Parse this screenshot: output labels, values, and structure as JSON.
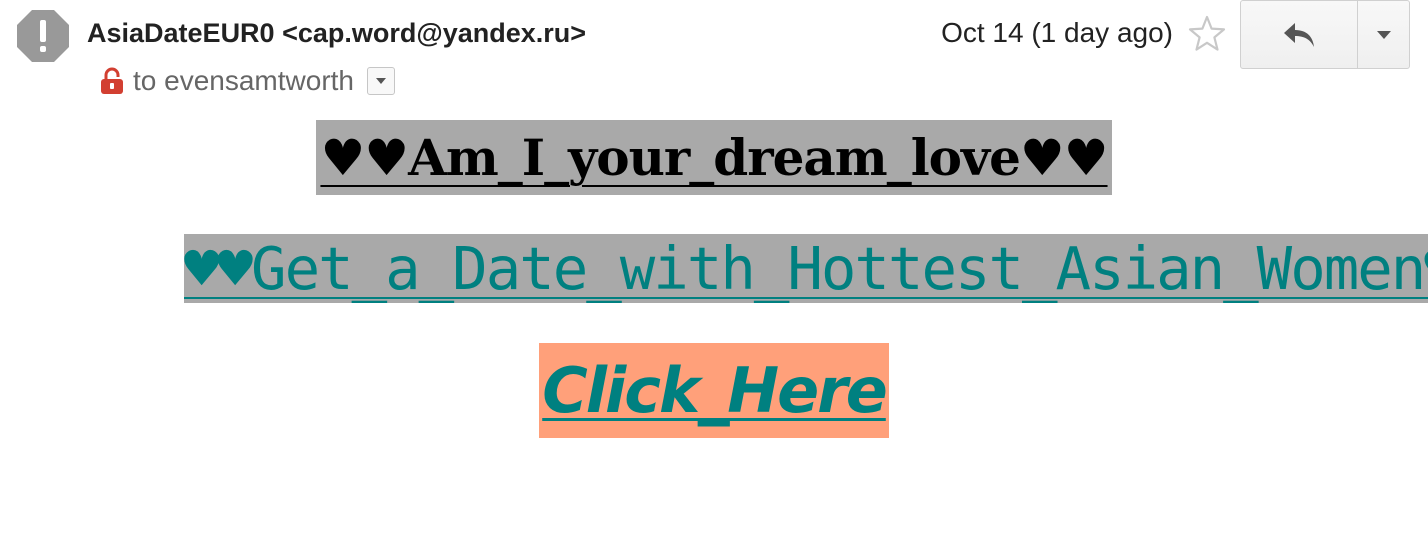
{
  "header": {
    "sender": "AsiaDateEUR0 <cap.word@yandex.ru>",
    "recipient": "to evensamtworth",
    "date": "Oct 14 (1 day ago)",
    "avatar_icon": "warning-octagon-icon",
    "lock_icon": "lock-open-icon",
    "star_icon": "star-outline-icon",
    "reply_icon": "reply-arrow-icon",
    "more_icon": "caret-down-icon"
  },
  "email_body": {
    "headline": "♥♥Am_I_your_dream_love♥♥",
    "offer_link": "♥♥Get_a_Date_with_Hottest_Asian_Women♥♥",
    "cta_button": "Click_Here"
  },
  "colors": {
    "highlight_gray": "#a9a9a9",
    "link_teal": "#008080",
    "button_salmon": "#ffa07a",
    "lock_red": "#d23f31"
  }
}
